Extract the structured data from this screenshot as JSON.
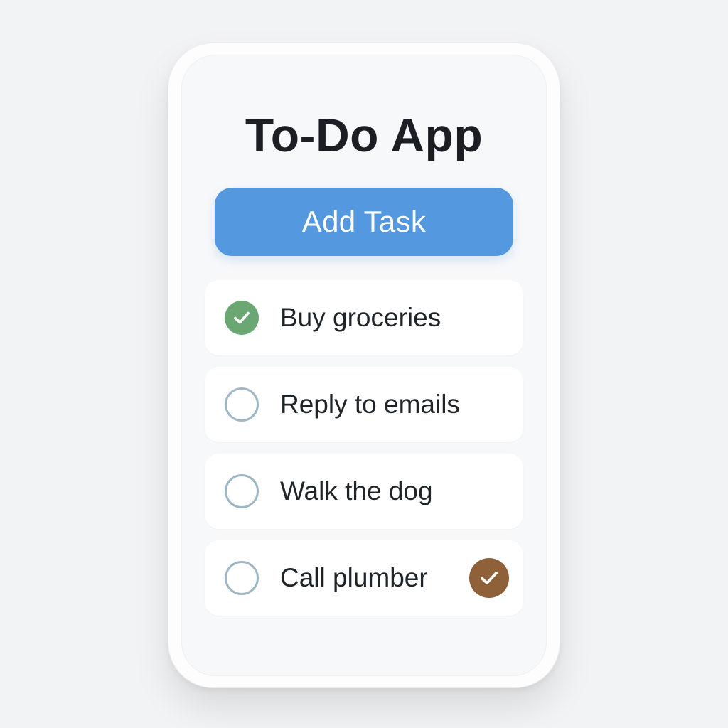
{
  "app": {
    "title": "To-Do App",
    "add_button_label": "Add Task"
  },
  "colors": {
    "accent": "#5499e0",
    "done": "#6aa773",
    "badge": "#8f6139"
  },
  "tasks": [
    {
      "label": "Buy groceries",
      "completed": true,
      "icon": "check-circle-filled-icon"
    },
    {
      "label": "Reply to emails",
      "completed": false,
      "icon": "empty-circle-icon"
    },
    {
      "label": "Walk the dog",
      "completed": false,
      "icon": "empty-circle-icon"
    },
    {
      "label": "Call plumber",
      "completed": false,
      "icon": "empty-circle-icon",
      "badge_icon": "check-badge-icon"
    }
  ]
}
